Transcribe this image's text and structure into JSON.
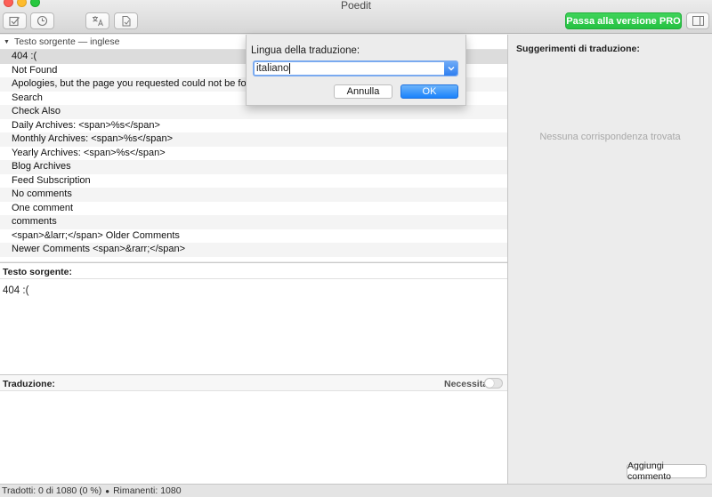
{
  "window": {
    "title": "Poedit",
    "pro_button": "Passa alla versione PRO"
  },
  "toolbar": {
    "buttons": [
      {
        "icon": "validate-icon"
      },
      {
        "icon": "history-icon"
      },
      {
        "icon": "translate-icon"
      },
      {
        "icon": "pretranslate-icon"
      },
      {
        "icon": "sidebar-toggle-icon"
      }
    ]
  },
  "list": {
    "header": "Testo sorgente — inglese",
    "rows": [
      "404 :(",
      "Not Found",
      "Apologies, but the page you requested could not be found...",
      "Search",
      "Check Also",
      "Daily Archives: <span>%s</span>",
      "Monthly Archives: <span>%s</span>",
      "Yearly Archives: <span>%s</span>",
      "Blog Archives",
      "Feed Subscription",
      "No comments",
      "One comment",
      "comments",
      "<span>&larr;</span> Older Comments",
      "Newer Comments <span>&rarr;</span>"
    ],
    "selected_index": 0
  },
  "source": {
    "label": "Testo sorgente:",
    "text": "404 :("
  },
  "translation": {
    "label": "Traduzione:",
    "needs_work_label": "Necessita",
    "needs_work_on": false
  },
  "suggestions": {
    "title": "Suggerimenti di traduzione:",
    "empty_text": "Nessuna corrispondenza trovata",
    "add_comment": "Aggiungi commento"
  },
  "status": {
    "translated": "Tradotti: 0 di 1080 (0 %)",
    "remaining": "Rimanenti: 1080"
  },
  "dialog": {
    "label": "Lingua della traduzione:",
    "value": "italiano",
    "cancel": "Annulla",
    "ok": "OK"
  },
  "colors": {
    "pro": "#25c142",
    "accent": "#1a82fb"
  }
}
